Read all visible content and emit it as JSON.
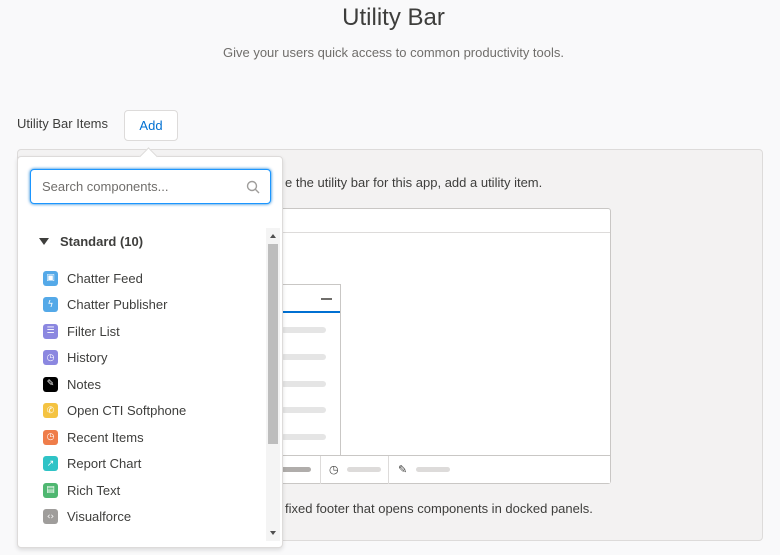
{
  "header": {
    "title": "Utility Bar",
    "subtitle": "Give your users quick access to common productivity tools."
  },
  "utility_bar": {
    "label": "Utility Bar Items",
    "add_label": "Add"
  },
  "panel": {
    "top_text": "e the utility bar for this app, add a utility item.",
    "bottom_text": "fixed footer that opens components in docked panels."
  },
  "popover": {
    "search_placeholder": "Search components...",
    "section_title": "Standard (10)",
    "items": [
      {
        "label": "Chatter Feed",
        "icon": "chatter-feed-icon",
        "color": "#54a9e8",
        "glyph": "▣"
      },
      {
        "label": "Chatter Publisher",
        "icon": "lightning-icon",
        "color": "#54a9e8",
        "glyph": "ϟ"
      },
      {
        "label": "Filter List",
        "icon": "filter-list-icon",
        "color": "#8b87e0",
        "glyph": "☰"
      },
      {
        "label": "History",
        "icon": "history-clock-icon",
        "color": "#8b87e0",
        "glyph": "◷"
      },
      {
        "label": "Notes",
        "icon": "notes-icon",
        "color": "#000000",
        "glyph": "✎"
      },
      {
        "label": "Open CTI Softphone",
        "icon": "phone-icon",
        "color": "#f4c342",
        "glyph": "✆"
      },
      {
        "label": "Recent Items",
        "icon": "recent-items-icon",
        "color": "#ef7d4a",
        "glyph": "◷"
      },
      {
        "label": "Report Chart",
        "icon": "report-chart-icon",
        "color": "#2fc3c6",
        "glyph": "↗"
      },
      {
        "label": "Rich Text",
        "icon": "rich-text-icon",
        "color": "#4fb771",
        "glyph": "▤"
      },
      {
        "label": "Visualforce",
        "icon": "visualforce-icon",
        "color": "#9f9d9b",
        "glyph": "‹›"
      }
    ]
  },
  "colors": {
    "accent": "#0070d2",
    "focus": "#1b96ff"
  }
}
